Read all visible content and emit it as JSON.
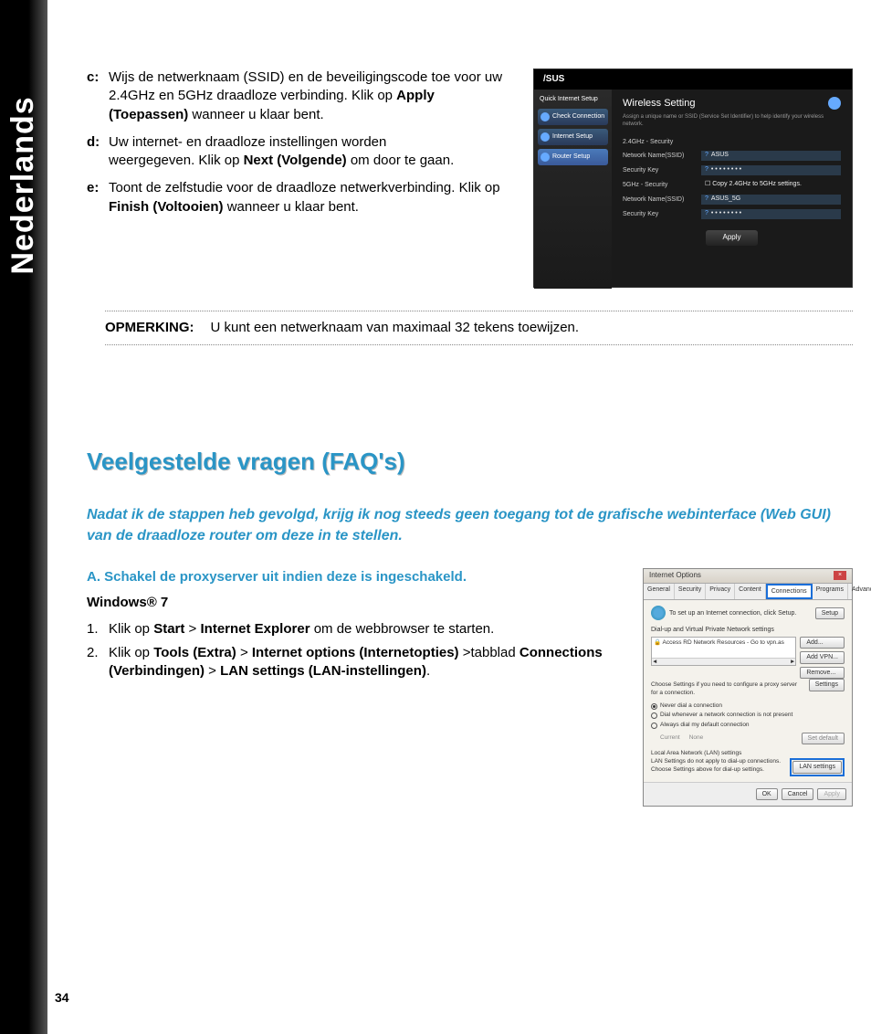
{
  "sidebar_label": "Nederlands",
  "page_number": "34",
  "steps": {
    "c": {
      "label": "c:",
      "pre": "Wijs de netwerknaam (SSID) en de beveiligingscode toe voor uw 2.4GHz en 5GHz draadloze verbinding. Klik op ",
      "bold": "Apply (Toepassen)",
      "post": " wanneer u klaar bent."
    },
    "d": {
      "label": "d:",
      "line1": "Uw internet- en draadloze instellingen worden",
      "line2_pre": "weergegeven. Klik op ",
      "line2_bold": "Next (Volgende)",
      "line2_post": " om door te gaan."
    },
    "e": {
      "label": "e:",
      "pre": "Toont de zelfstudie voor de draadloze netwerkverbinding. Klik op ",
      "bold": "Finish (Voltooien)",
      "post": " wanneer u klaar bent."
    }
  },
  "note": {
    "label": "OPMERKING:",
    "text": "U kunt een netwerknaam van maximaal 32 tekens toewijzen."
  },
  "faq": {
    "heading": "Veelgestelde vragen (FAQ's)",
    "intro": "Nadat ik de stappen heb gevolgd, krijg ik nog steeds geen toegang tot de grafische webinterface (Web GUI) van de draadloze router om deze in te stellen.",
    "sub_a": "A.   Schakel de proxyserver uit indien deze is ingeschakeld.",
    "windows": "Windows® 7",
    "step1": {
      "num": "1.",
      "pre": "Klik op ",
      "b1": "Start",
      "mid1": " > ",
      "b2": "Internet Explorer",
      "post": " om de webbrowser te starten."
    },
    "step2": {
      "num": "2.",
      "pre": "Klik op ",
      "b1": "Tools (Extra)",
      "mid1": " > ",
      "b2": "Internet options (Internetopties)",
      "mid2": " >tabblad ",
      "b3": "Connections (Verbindingen)",
      "mid3": " > ",
      "b4": "LAN settings (LAN-instellingen)",
      "post": "."
    }
  },
  "router": {
    "logo": "/SUS",
    "side_header": "Quick Internet Setup",
    "side": [
      "Check Connection",
      "Internet Setup",
      "Router Setup"
    ],
    "title": "Wireless Setting",
    "desc": "Assign a unique name or SSID (Service Set Identifier) to help identify your wireless network.",
    "rows": {
      "sec24": "2.4GHz - Security",
      "ssid1_lbl": "Network Name(SSID)",
      "ssid1_val": "ASUS",
      "key1_lbl": "Security Key",
      "key1_val": "• • • • • • • •",
      "sec5": "5GHz - Security",
      "copy": "Copy 2.4GHz to 5GHz settings.",
      "ssid2_lbl": "Network Name(SSID)",
      "ssid2_val": "ASUS_5G",
      "key2_lbl": "Security Key",
      "key2_val": "• • • • • • • •"
    },
    "apply": "Apply"
  },
  "ie": {
    "title": "Internet Options",
    "tabs": [
      "General",
      "Security",
      "Privacy",
      "Content",
      "Connections",
      "Programs",
      "Advanced"
    ],
    "setup_text": "To set up an Internet connection, click Setup.",
    "setup_btn": "Setup",
    "vpn_header": "Dial-up and Virtual Private Network settings",
    "vpn_item": "Access RD Network Resources - Go to vpn.as",
    "btns": {
      "add": "Add...",
      "addvpn": "Add VPN...",
      "remove": "Remove...",
      "settings": "Settings",
      "setdefault": "Set default",
      "lan": "LAN settings"
    },
    "hint1": "Choose Settings if you need to configure a proxy server for a connection.",
    "radio1": "Never dial a connection",
    "radio2": "Dial whenever a network connection is not present",
    "radio3": "Always dial my default connection",
    "current_lbl": "Current",
    "current_val": "None",
    "lan_header": "Local Area Network (LAN) settings",
    "lan_text": "LAN Settings do not apply to dial-up connections. Choose Settings above for dial-up settings.",
    "ok": "OK",
    "cancel": "Cancel",
    "apply": "Apply"
  }
}
